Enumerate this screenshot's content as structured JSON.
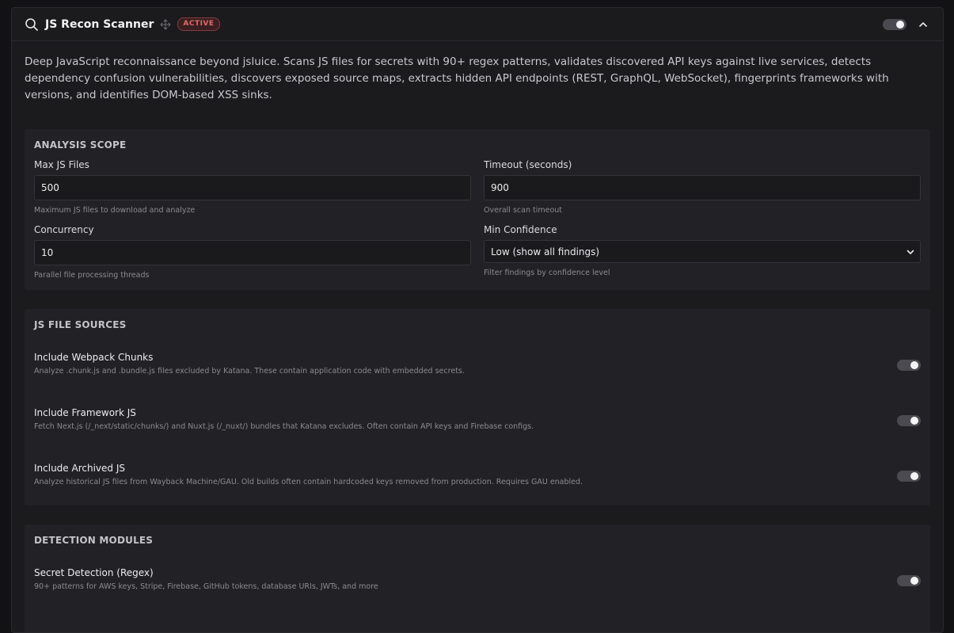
{
  "header": {
    "title": "JS Recon Scanner",
    "badge": "ACTIVE",
    "icons": [
      "search-icon",
      "move-icon",
      "chevron-up-icon"
    ]
  },
  "description": "Deep JavaScript reconnaissance beyond jsluice. Scans JS files for secrets with 90+ regex patterns, validates discovered API keys against live services, detects dependency confusion vulnerabilities, discovers exposed source maps, extracts hidden API endpoints (REST, GraphQL, WebSocket), fingerprints frameworks with versions, and identifies DOM-based XSS sinks.",
  "analysis_scope": {
    "title": "ANALYSIS SCOPE",
    "max_js_files": {
      "label": "Max JS Files",
      "value": "500",
      "hint": "Maximum JS files to download and analyze"
    },
    "timeout": {
      "label": "Timeout (seconds)",
      "value": "900",
      "hint": "Overall scan timeout"
    },
    "concurrency": {
      "label": "Concurrency",
      "value": "10",
      "hint": "Parallel file processing threads"
    },
    "min_confidence": {
      "label": "Min Confidence",
      "value": "Low (show all findings)",
      "hint": "Filter findings by confidence level"
    }
  },
  "js_file_sources": {
    "title": "JS FILE SOURCES",
    "items": [
      {
        "title": "Include Webpack Chunks",
        "desc": "Analyze .chunk.js and .bundle.js files excluded by Katana. These contain application code with embedded secrets."
      },
      {
        "title": "Include Framework JS",
        "desc": "Fetch Next.js (/_next/static/chunks/) and Nuxt.js (/_nuxt/) bundles that Katana excludes. Often contain API keys and Firebase configs."
      },
      {
        "title": "Include Archived JS",
        "desc": "Analyze historical JS files from Wayback Machine/GAU. Old builds often contain hardcoded keys removed from production. Requires GAU enabled."
      }
    ]
  },
  "detection_modules": {
    "title": "DETECTION MODULES",
    "items": [
      {
        "title": "Secret Detection (Regex)",
        "desc": "90+ patterns for AWS keys, Stripe, Firebase, GitHub tokens, database URIs, JWTs, and more"
      }
    ]
  },
  "colors": {
    "active_badge": "#e06a6a",
    "background": "#1b1b1e",
    "card": "#222226"
  }
}
